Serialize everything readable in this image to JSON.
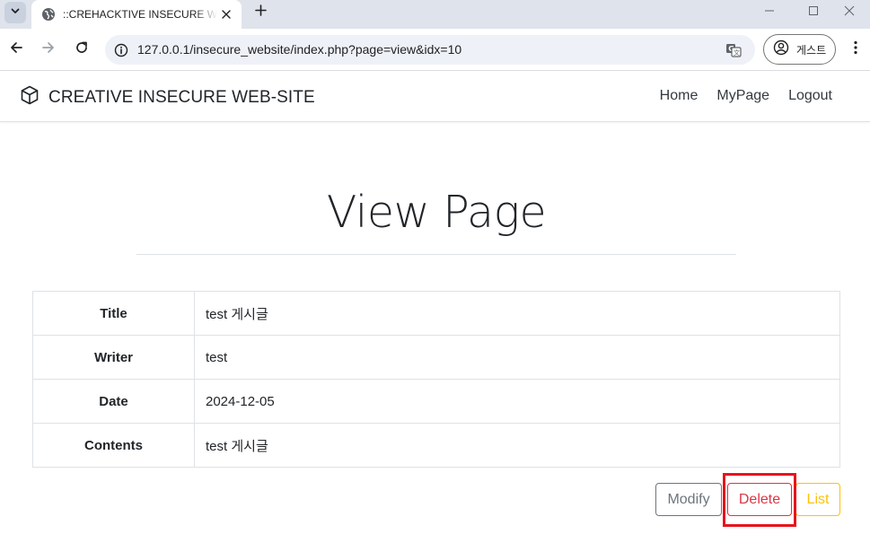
{
  "browser": {
    "tab": {
      "title": "::CREHACKTIVE INSECURE WEB-SITE::"
    },
    "address_bar": {
      "url": "127.0.0.1/insecure_website/index.php?page=view&idx=10"
    },
    "profile": {
      "label": "게스트"
    }
  },
  "site": {
    "brand": "CREATIVE INSECURE WEB-SITE",
    "nav": [
      {
        "label": "Home"
      },
      {
        "label": "MyPage"
      },
      {
        "label": "Logout"
      }
    ]
  },
  "page": {
    "heading": "View Page",
    "rows": [
      {
        "label": "Title",
        "value": "test 게시글"
      },
      {
        "label": "Writer",
        "value": "test"
      },
      {
        "label": "Date",
        "value": "2024-12-05"
      },
      {
        "label": "Contents",
        "value": "test 게시글"
      }
    ],
    "buttons": {
      "modify": "Modify",
      "delete": "Delete",
      "list": "List"
    }
  },
  "colors": {
    "modify": "#6c757d",
    "delete": "#dc3545",
    "list": "#ffc107",
    "highlight": "#e8141c"
  },
  "icons": {
    "tab_search": "chevron-down-icon",
    "favicon": "globe-icon",
    "tab_close": "close-icon",
    "new_tab": "plus-icon",
    "back": "arrow-left-icon",
    "forward": "arrow-right-icon",
    "reload": "reload-icon",
    "site_info": "info-icon",
    "translate": "translate-icon",
    "profile": "account-icon",
    "menu": "kebab-menu-icon",
    "brand": "cube-icon"
  }
}
